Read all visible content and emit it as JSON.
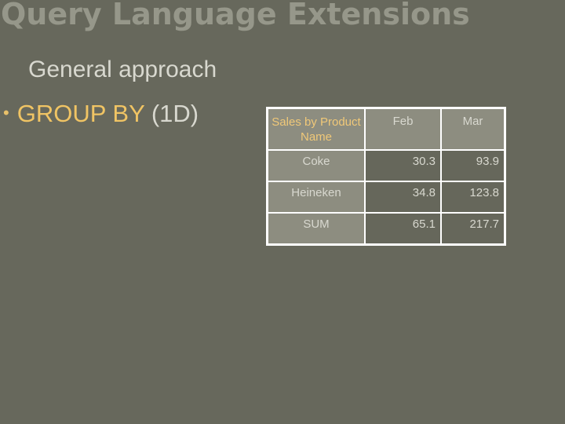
{
  "slide": {
    "title": "Query Language Extensions",
    "subtitle": "General approach",
    "bullet": {
      "marker": "•",
      "keyword": "GROUP BY",
      "suffix": "(1D)"
    }
  },
  "table": {
    "corner_header": "Sales by Product Name",
    "columns": [
      "Feb",
      "Mar"
    ],
    "rows": [
      {
        "label": "Coke",
        "values": [
          "30.3",
          "93.9"
        ]
      },
      {
        "label": "Heineken",
        "values": [
          "34.8",
          "123.8"
        ]
      },
      {
        "label": "SUM",
        "values": [
          "65.1",
          "217.7"
        ]
      }
    ]
  },
  "colors": {
    "background": "#67685c",
    "title": "#96978a",
    "keyword": "#f0c464",
    "text": "#d8d8cf",
    "header_cell": "#8d8d80",
    "border": "#ffffff"
  }
}
